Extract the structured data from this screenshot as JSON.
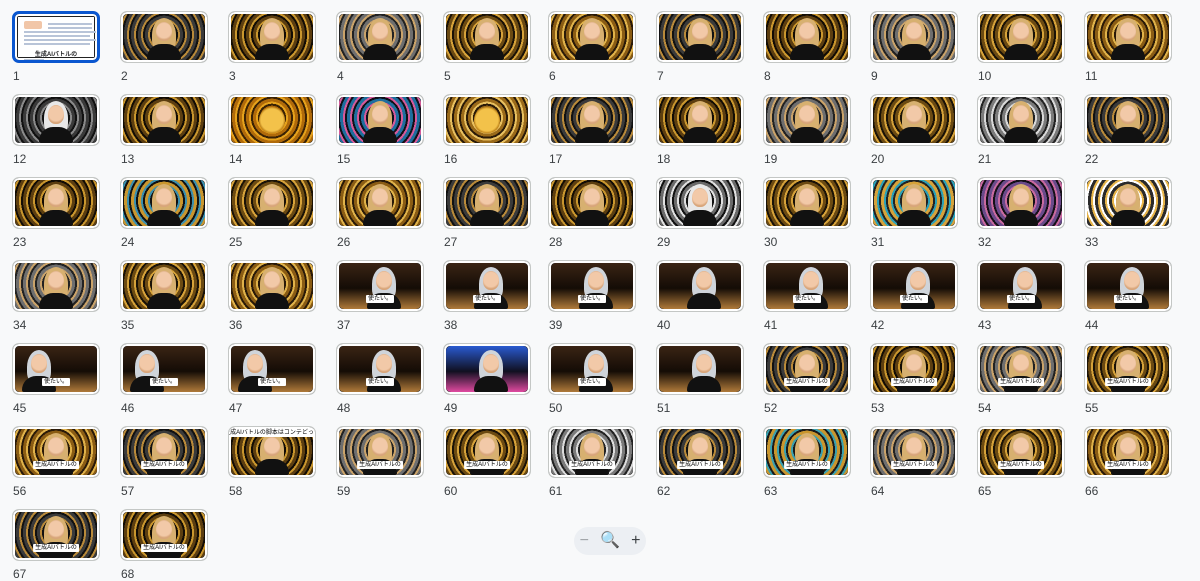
{
  "slides": {
    "selected": "1",
    "numbers": [
      "1",
      "2",
      "3",
      "4",
      "5",
      "6",
      "7",
      "8",
      "9",
      "10",
      "11",
      "12",
      "13",
      "14",
      "15",
      "16",
      "17",
      "18",
      "19",
      "20",
      "21",
      "22",
      "23",
      "24",
      "25",
      "26",
      "27",
      "28",
      "29",
      "30",
      "31",
      "32",
      "33",
      "34",
      "35",
      "36",
      "37",
      "38",
      "39",
      "40",
      "41",
      "42",
      "43",
      "44",
      "45",
      "46",
      "47",
      "48",
      "49",
      "50",
      "51",
      "52",
      "53",
      "54",
      "55",
      "56",
      "57",
      "58",
      "59",
      "60",
      "61",
      "62",
      "63",
      "64",
      "65",
      "66",
      "67",
      "68"
    ],
    "cover_title": "生成AIバトルの",
    "captions": {
      "37": "使たい。",
      "38": "使たい。",
      "39": "使たい。",
      "41": "使たい。",
      "42": "使たい。",
      "43": "使たい。",
      "44": "使たい。",
      "45": "使たい。",
      "46": "使たい。",
      "47": "使たい。",
      "48": "使たい。",
      "50": "使たい。",
      "52": "生成AIバトルの",
      "53": "生成AIバトルの",
      "54": "生成AIバトルの",
      "55": "生成AIバトルの",
      "56": "生成AIバトルの",
      "57": "生成AIバトルの",
      "58": "生成AIバトルの脚本はコンテどっち",
      "59": "生成AIバトルの",
      "60": "生成AIバトルの",
      "61": "生成AIバトルの",
      "62": "生成AIバトルの",
      "63": "生成AIバトルの",
      "64": "生成AIバトルの",
      "65": "生成AIバトルの",
      "66": "生成AIバトルの",
      "67": "生成AIバトルの",
      "68": "生成AIバトルの"
    }
  },
  "zoom": {
    "minus_icon": "−",
    "zoom_icon": "🔍",
    "plus_icon": "+"
  },
  "colors": {
    "selected_border": "#0b57d0",
    "gold": "#c9962e",
    "dark": "#1a1208"
  }
}
